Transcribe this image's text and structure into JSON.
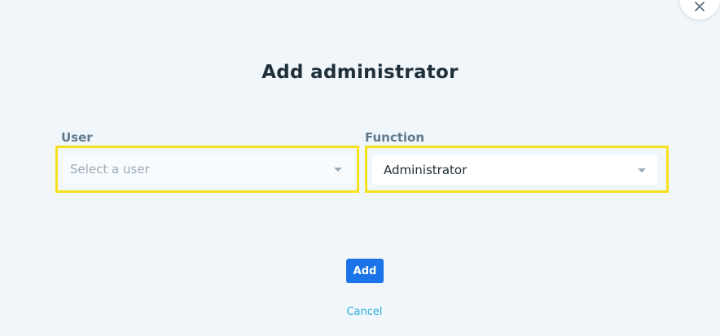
{
  "dialog": {
    "title": "Add administrator",
    "close_icon": "close-icon"
  },
  "form": {
    "user": {
      "label": "User",
      "placeholder": "Select a user",
      "value": ""
    },
    "function": {
      "label": "Function",
      "value": "Administrator"
    }
  },
  "actions": {
    "add_label": "Add",
    "cancel_label": "Cancel"
  },
  "colors": {
    "background": "#f1f6fb",
    "accent": "#1a73e8",
    "link": "#2aaed8",
    "highlight": "#f5e01c"
  }
}
